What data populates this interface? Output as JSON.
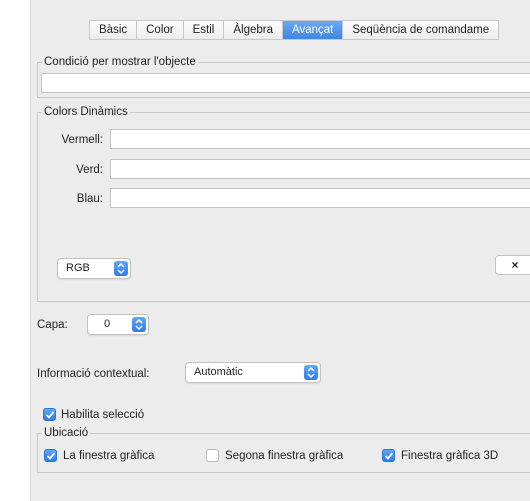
{
  "tabs": [
    {
      "label": "Bàsic",
      "active": false
    },
    {
      "label": "Color",
      "active": false
    },
    {
      "label": "Estil",
      "active": false
    },
    {
      "label": "Àlgebra",
      "active": false
    },
    {
      "label": "Avançat",
      "active": true
    },
    {
      "label": "Seqüència de comandame",
      "active": false
    }
  ],
  "condition": {
    "title": "Condició per mostrar l'objecte",
    "value": ""
  },
  "dynamic_colors": {
    "title": "Colors Dinàmics",
    "red_label": "Vermell:",
    "red_value": "",
    "green_label": "Verd:",
    "green_value": "",
    "blue_label": "Blau:",
    "blue_value": "",
    "color_space": "RGB",
    "clear_button": "×"
  },
  "layer": {
    "label": "Capa:",
    "value": "0"
  },
  "tooltip": {
    "label": "Informació contextual:",
    "value": "Automàtic"
  },
  "selection": {
    "label": "Habilita selecció",
    "checked": true
  },
  "location": {
    "title": "Ubicació",
    "options": [
      {
        "label": "La finestra gràfica",
        "checked": true
      },
      {
        "label": "Segona finestra gràfica",
        "checked": false
      },
      {
        "label": "Finestra gràfica 3D",
        "checked": true
      }
    ]
  },
  "colors": {
    "accent": "#3d86e6",
    "panel": "#ececec"
  }
}
